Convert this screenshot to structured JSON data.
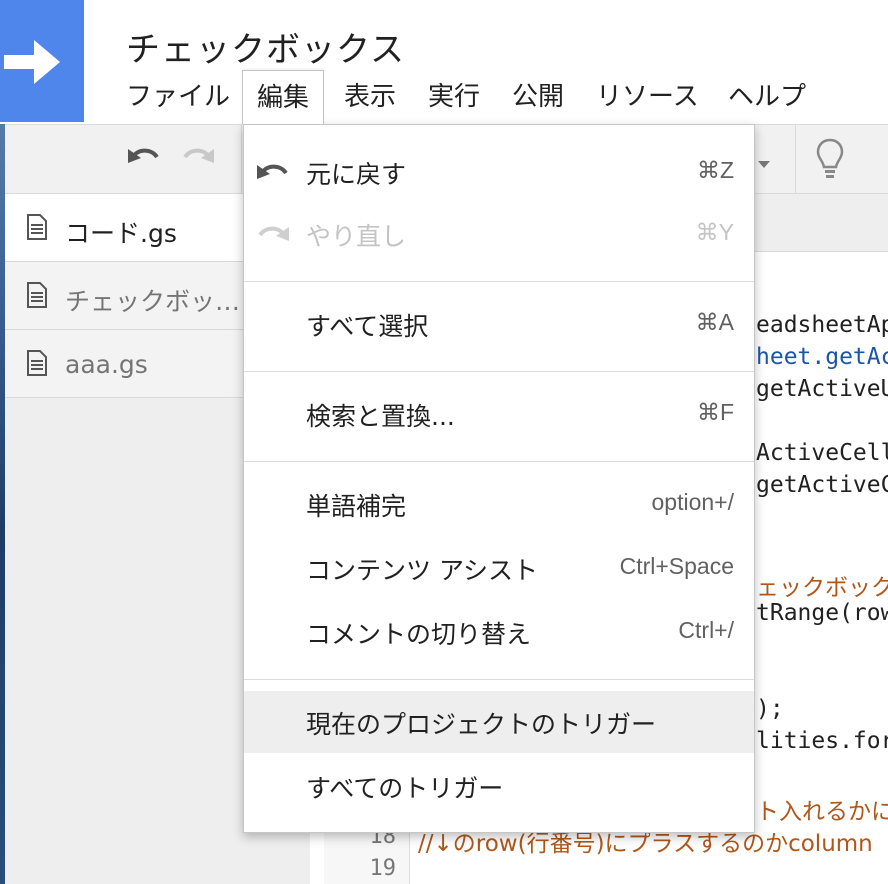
{
  "project": {
    "title": "チェックボックス"
  },
  "menubar": {
    "items": [
      {
        "label": "ファイル"
      },
      {
        "label": "編集"
      },
      {
        "label": "表示"
      },
      {
        "label": "実行"
      },
      {
        "label": "公開"
      },
      {
        "label": "リソース"
      },
      {
        "label": "ヘルプ"
      }
    ],
    "active": "編集"
  },
  "toolbar": {
    "undo_icon": "undo-icon",
    "redo_icon": "redo-icon",
    "lightbulb_icon": "lightbulb-icon",
    "dropdown_icon": "caret-down-icon"
  },
  "files": [
    {
      "name": "コード.gs",
      "selected": true
    },
    {
      "name": "チェックボッ…",
      "selected": false
    },
    {
      "name": "aaa.gs",
      "selected": false
    }
  ],
  "edit_menu": {
    "items": [
      {
        "label": "元に戻す",
        "shortcut": "⌘Z",
        "icon": "undo-icon",
        "enabled": true
      },
      {
        "label": "やり直し",
        "shortcut": "⌘Y",
        "icon": "redo-icon",
        "enabled": false
      },
      {
        "label": "すべて選択",
        "shortcut": "⌘A",
        "enabled": true
      },
      {
        "label": "検索と置換...",
        "shortcut": "⌘F",
        "enabled": true
      },
      {
        "label": "単語補完",
        "shortcut": "option+/",
        "enabled": true
      },
      {
        "label": "コンテンツ アシスト",
        "shortcut": "Ctrl+Space",
        "enabled": true
      },
      {
        "label": "コメントの切り替え",
        "shortcut": "Ctrl+/",
        "enabled": true
      },
      {
        "label": "現在のプロジェクトのトリガー",
        "shortcut": "",
        "enabled": true,
        "highlighted": true
      },
      {
        "label": "すべてのトリガー",
        "shortcut": "",
        "enabled": true
      }
    ]
  },
  "code": {
    "lines": [
      "eadsheetAp",
      "heet.getAc",
      "getActiveU",
      "ActiveCell",
      "getActiveC",
      "ェックボックス",
      "tRange(row",
      ");",
      "lities.for",
      "ト入れるかに",
      "//↓のrow(行番号)にプラスするのかcolumn"
    ],
    "line_numbers": [
      "18",
      "19"
    ]
  }
}
